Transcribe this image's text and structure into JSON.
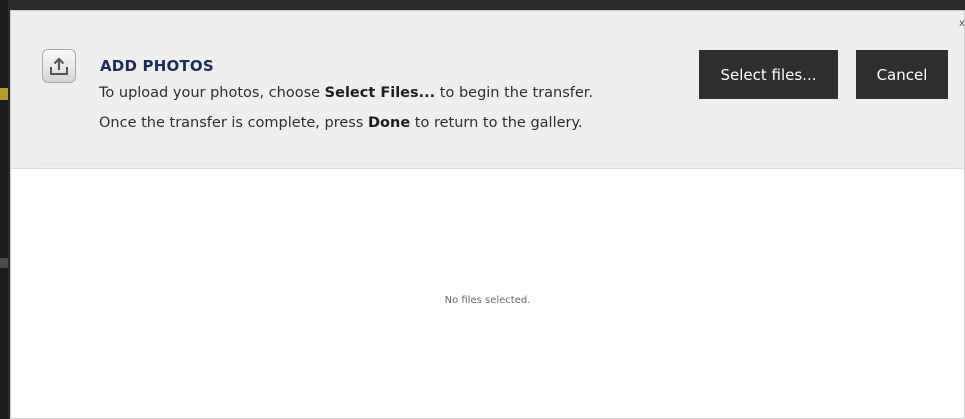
{
  "dialog": {
    "title": "ADD PHOTOS",
    "instructions": {
      "line1_pre": "To upload your photos, choose ",
      "line1_bold": "Select Files...",
      "line1_post": " to begin the transfer.",
      "line2_pre": "Once the transfer is complete, press ",
      "line2_bold": "Done",
      "line2_post": " to return to the gallery."
    },
    "buttons": {
      "select_files": "Select files...",
      "cancel": "Cancel"
    },
    "close_label": "x",
    "empty_message": "No files selected.",
    "icon": "upload-tray-icon"
  },
  "colors": {
    "title": "#1f2a5c",
    "button_bg": "#2f2f2f",
    "button_text": "#ffffff",
    "header_bg": "#efefef"
  }
}
